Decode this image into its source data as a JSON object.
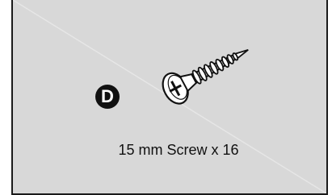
{
  "part": {
    "letter": "D",
    "caption": "15 mm Screw x 16",
    "icon": "screw-icon"
  },
  "colors": {
    "panel_background": "#d8d8d8",
    "border": "#1a1a1a",
    "badge": "#111111"
  }
}
